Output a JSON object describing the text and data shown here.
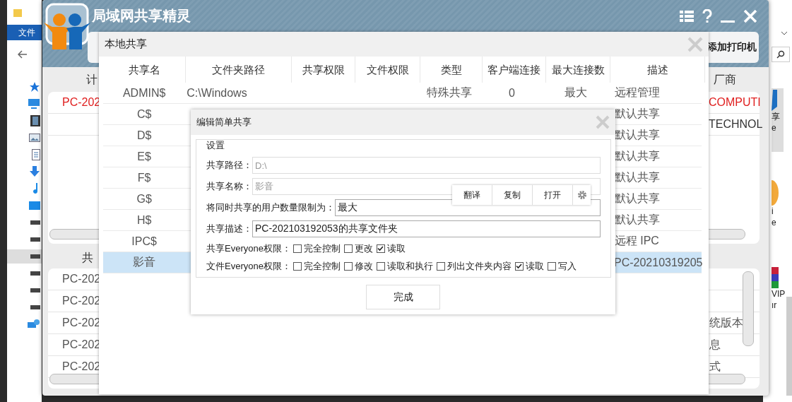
{
  "explorer": {
    "ribbon_tab": "文件",
    "side_items": [
      {
        "kind": "tile",
        "lines": [
          "享",
          "e"
        ]
      },
      {
        "kind": "orange",
        "lines": [
          "i",
          "e"
        ]
      },
      {
        "kind": "books",
        "lines": [
          "VIP",
          "ır"
        ]
      }
    ]
  },
  "app": {
    "title": "局域网共享精灵",
    "toolbar_button": "添加打印机",
    "computers": {
      "heading": "计",
      "vendor_heading": "厂商",
      "rows": [
        {
          "name": "PC-202",
          "vendor": "COMPUTI",
          "highlighted": true
        },
        {
          "vendor": "TECHNOL",
          "highlighted": false
        }
      ]
    },
    "shares": {
      "heading": "共",
      "rows": [
        {
          "name": "PC-202"
        },
        {
          "name": "PC-202"
        },
        {
          "name": "PC-202",
          "info": "统版本"
        },
        {
          "name": "PC-202",
          "info": "息"
        },
        {
          "name": "PC-202",
          "info": "式"
        }
      ]
    }
  },
  "local_share": {
    "title": "本地共享",
    "columns": [
      "共享名",
      "文件夹路径",
      "共享权限",
      "文件权限",
      "类型",
      "客户端连接",
      "最大连接数",
      "描述"
    ],
    "rows": [
      {
        "name": "ADMIN$",
        "path": "C:\\Windows",
        "type": "特殊共享",
        "clients": "0",
        "max": "最大",
        "description": "远程管理",
        "selected": false
      },
      {
        "name": "C$",
        "description": "默认共享",
        "selected": false
      },
      {
        "name": "D$",
        "description": "默认共享",
        "selected": false
      },
      {
        "name": "E$",
        "description": "默认共享",
        "selected": false
      },
      {
        "name": "F$",
        "description": "默认共享",
        "selected": false
      },
      {
        "name": "G$",
        "description": "默认共享",
        "selected": false
      },
      {
        "name": "H$",
        "description": "默认共享",
        "selected": false
      },
      {
        "name": "IPC$",
        "description": "远程 IPC",
        "selected": false
      },
      {
        "name": "影音",
        "description": "PC-20210319205",
        "selected": true
      }
    ]
  },
  "edit_dialog": {
    "title": "编辑简单共享",
    "group": "设置",
    "fields": [
      {
        "label": "共享路径：",
        "value": "D:\\",
        "disabled": true
      },
      {
        "label": "共享名称：",
        "value": "影音",
        "disabled": true
      },
      {
        "label": "将同时共享的用户数量限制为：",
        "value": "最大",
        "disabled": false
      },
      {
        "label": "共享描述：",
        "value": "PC-202103192053的共享文件夹",
        "disabled": false
      }
    ],
    "permissions": [
      {
        "label": "共享Everyone权限：",
        "options": [
          {
            "label": "完全控制",
            "checked": false
          },
          {
            "label": "更改",
            "checked": false
          },
          {
            "label": "读取",
            "checked": true
          }
        ]
      },
      {
        "label": "文件Everyone权限：",
        "options": [
          {
            "label": "完全控制",
            "checked": false
          },
          {
            "label": "修改",
            "checked": false
          },
          {
            "label": "读取和执行",
            "checked": false
          },
          {
            "label": "列出文件夹内容",
            "checked": false
          },
          {
            "label": "读取",
            "checked": true
          },
          {
            "label": "写入",
            "checked": false
          }
        ]
      }
    ],
    "button": "完成"
  },
  "popup": {
    "items": [
      "翻译",
      "复制",
      "打开"
    ]
  }
}
